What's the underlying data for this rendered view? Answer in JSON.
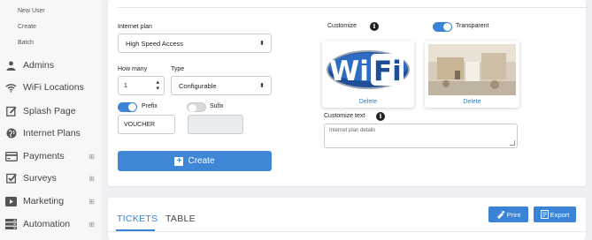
{
  "sidebar": {
    "subitems": [
      "New User",
      "Create",
      "Batch"
    ],
    "items": [
      {
        "label": "Admins",
        "icon": "user-icon",
        "expandable": false
      },
      {
        "label": "WiFi Locations",
        "icon": "wifi-icon",
        "expandable": false
      },
      {
        "label": "Splash Page",
        "icon": "edit-icon",
        "expandable": false
      },
      {
        "label": "Internet Plans",
        "icon": "globe-icon",
        "expandable": false
      },
      {
        "label": "Payments",
        "icon": "credit-card-icon",
        "expandable": true
      },
      {
        "label": "Surveys",
        "icon": "checkbox-icon",
        "expandable": true
      },
      {
        "label": "Marketing",
        "icon": "play-icon",
        "expandable": true
      },
      {
        "label": "Automation",
        "icon": "server-icon",
        "expandable": true
      }
    ],
    "expand_symbol": "⊞"
  },
  "form": {
    "internet_plan_label": "Internet plan",
    "internet_plan_value": "High Speed Access",
    "how_many_label": "How many",
    "how_many_value": "1",
    "type_label": "Type",
    "type_value": "Configurable",
    "prefix_label": "Prefix",
    "prefix_on": true,
    "prefix_value": "VOUCHER",
    "sufix_label": "Sufix",
    "sufix_on": false,
    "sufix_value": "",
    "create_label": "Create"
  },
  "customize": {
    "label": "Customize",
    "transparent_label": "Transparent",
    "transparent_on": true,
    "logo_text": "WiFi",
    "delete_label": "Delete",
    "customize_text_label": "Customize text",
    "text_placeholder": "Internet plan details"
  },
  "bottom": {
    "tabs": [
      "TICKETS",
      "TABLE"
    ],
    "active_tab": "TICKETS",
    "print_label": "Print",
    "export_label": "Export"
  },
  "colors": {
    "accent": "#3b83d6",
    "sidebar_bg": "#f7f7f7",
    "page_bg": "#eef0f3"
  }
}
